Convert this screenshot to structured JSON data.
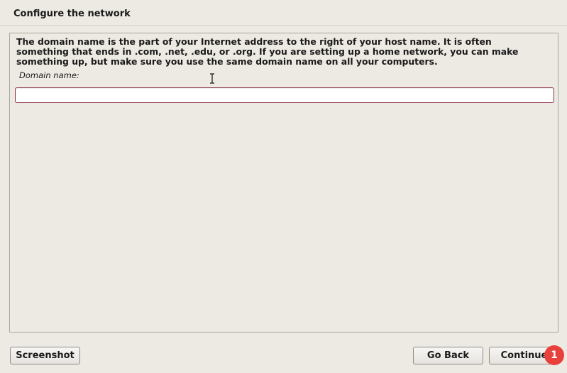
{
  "header": {
    "title": "Configure the network"
  },
  "main": {
    "description": "The domain name is the part of your Internet address to the right of your host name.  It is often\nsomething that ends in .com, .net, .edu, or .org.  If you are setting up a home network, you can make\nsomething up, but make sure you use the same domain name on all your computers.",
    "domain_field": {
      "label": "Domain name:",
      "value": ""
    }
  },
  "footer": {
    "screenshot_label": "Screenshot",
    "go_back_label": "Go Back",
    "continue_label": "Continue",
    "continue_badge": "1"
  },
  "colors": {
    "background": "#ede9e3",
    "input_border": "#8a2e4a",
    "badge": "#e8403a"
  },
  "icons": {
    "cursor": "text-cursor-icon"
  }
}
